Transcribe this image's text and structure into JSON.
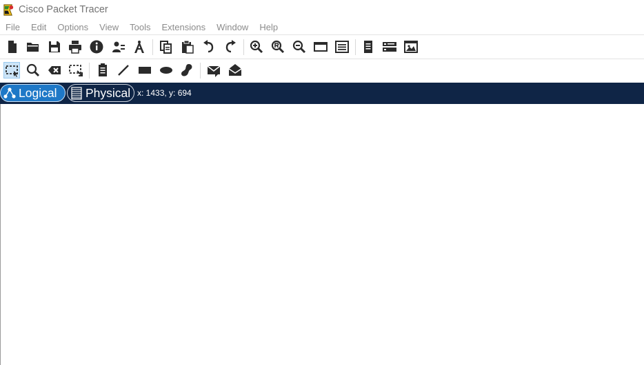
{
  "window": {
    "title": "Cisco Packet Tracer"
  },
  "menu": [
    "File",
    "Edit",
    "Options",
    "View",
    "Tools",
    "Extensions",
    "Window",
    "Help"
  ],
  "workspace": {
    "logical_label": "Logical",
    "physical_label": "Physical",
    "coords": "x: 1433, y: 694"
  },
  "colors": {
    "workspace_bar": "#0f2546",
    "logical_tab": "#1e78c7",
    "icon": "#2b2b2b"
  }
}
